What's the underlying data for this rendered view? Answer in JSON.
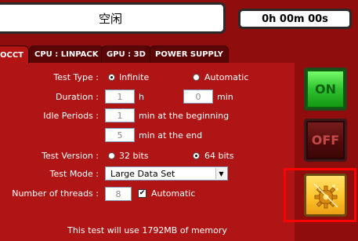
{
  "status": {
    "text": "空闲"
  },
  "timer": {
    "text": "0h 00m 00s"
  },
  "tabs": [
    {
      "label": "OCCT"
    },
    {
      "label": "CPU : LINPACK"
    },
    {
      "label": "GPU : 3D"
    },
    {
      "label": "POWER SUPPLY"
    }
  ],
  "form": {
    "test_type_label": "Test Type :",
    "test_type_options": [
      "Infinite",
      "Automatic"
    ],
    "test_type_selected": "Infinite",
    "duration_label": "Duration :",
    "duration_hours": "1",
    "duration_h_unit": "h",
    "duration_minutes": "0",
    "duration_min_unit": "min",
    "idle_label": "Idle Periods :",
    "idle_begin_value": "1",
    "idle_begin_text": "min at the beginning",
    "idle_end_value": "5",
    "idle_end_text": "min at the end",
    "version_label": "Test Version :",
    "version_options": [
      "32 bits",
      "64 bits"
    ],
    "version_selected": "64 bits",
    "mode_label": "Test Mode :",
    "mode_value": "Large Data Set",
    "threads_label": "Number of threads :",
    "threads_value": "8",
    "threads_auto_label": "Automatic",
    "threads_auto_checked": true
  },
  "footer": {
    "memory_text": "This test will use 1792MB of memory"
  },
  "buttons": {
    "on_label": "ON",
    "off_label": "OFF",
    "settings_icon": "gear-icon"
  },
  "colors": {
    "background": "#8f0d0d",
    "panel": "#b01515",
    "on_green": "#2ec12e",
    "off_dark": "#4d0a0a",
    "settings_yellow": "#ffc42c",
    "highlight": "#ff0000"
  }
}
